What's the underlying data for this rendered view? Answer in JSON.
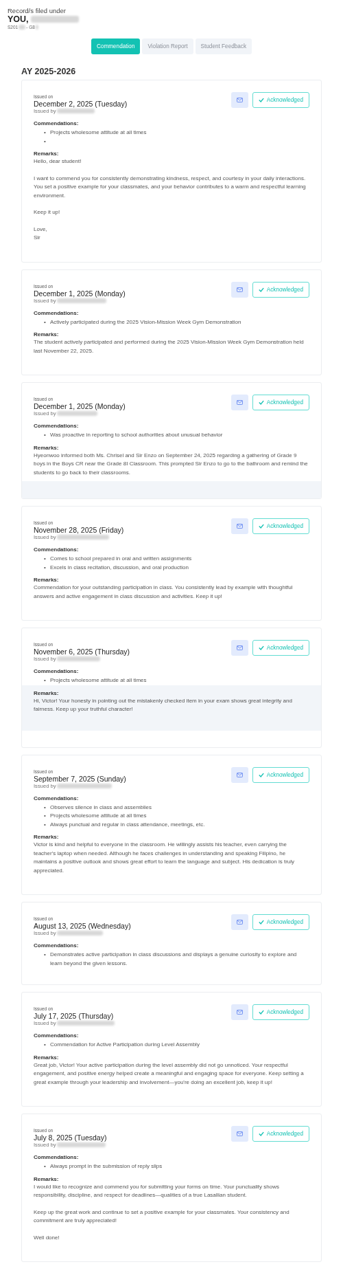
{
  "header": {
    "caption": "Record/s filed under",
    "name_prefix": "YOU,",
    "id_start": "S201",
    "id_mid": "- G8"
  },
  "tabs": [
    {
      "label": "Commendation",
      "selected": true
    },
    {
      "label": "Violation Report",
      "selected": false
    },
    {
      "label": "Student Feedback",
      "selected": false
    }
  ],
  "year": "AY 2025-2026",
  "bullet": "•",
  "records": [
    {
      "issued_on_label": "Issued on",
      "date": "December 2, 2025 (Tuesday)",
      "issued_by_label": "Issued by",
      "acknowledged": true,
      "ack_label": "Acknowledged",
      "commendations_label": "Commendations:",
      "commendations": [
        "Projects wholesome attitude at all times"
      ],
      "trailing_empty_item": true,
      "remarks_label": "Remarks:",
      "remarks": [
        "Hello, dear student!",
        "I want to commend you for consistently demonstrating kindness, respect, and courtesy in your daily interactions.\nYou set a positive example for your classmates, and your behavior contributes to a warm and respectful learning environment.",
        "Keep it up!",
        "Love,\nSir"
      ]
    },
    {
      "issued_on_label": "Issued on",
      "date": "December 1, 2025 (Monday)",
      "issued_by_label": "Issued by",
      "acknowledged": true,
      "ack_label": "Acknowledged",
      "commendations_label": "Commendations:",
      "commendations": [
        "Actively participated during the 2025 Vision-Mission Week Gym Demonstration"
      ],
      "remarks_label": "Remarks:",
      "remarks": [
        "The student actively participated and performed during the 2025 Vision-Mission Week Gym Demonstration held last November 22, 2025."
      ]
    },
    {
      "issued_on_label": "Issued on",
      "date": "December 1, 2025 (Monday)",
      "issued_by_label": "Issued by",
      "acknowledged": true,
      "ack_label": "Acknowledged",
      "commendations_label": "Commendations:",
      "commendations": [
        "Was proactive in reporting to school authorities about unusual behavior"
      ],
      "remarks_label": "Remarks:",
      "remarks": [
        "Hyeonwoo informed both Ms. Chrisel and Sir Enzo on September 24, 2025 regarding a gathering of Grade 9 boys in the Boys CR near the Grade 8I Classroom. This prompted Sir Enzo to go to the bathroom and remind the students to go back to their classrooms."
      ],
      "footer_shaded": true
    },
    {
      "issued_on_label": "Issued on",
      "date": "November 28, 2025 (Friday)",
      "issued_by_label": "Issued by",
      "acknowledged": true,
      "ack_label": "Acknowledged",
      "commendations_label": "Commendations:",
      "commendations": [
        "Comes to school prepared in oral and written assignments",
        "Excels in class recitation, discussion, and oral production"
      ],
      "remarks_label": "Remarks:",
      "remarks": [
        "Commendation for your outstanding participation in class. You consistently lead by example with thoughtful answers and active engagement in class discussion and activities. Keep it up!"
      ]
    },
    {
      "issued_on_label": "Issued on",
      "date": "November 6, 2025 (Thursday)",
      "issued_by_label": "Issued by",
      "acknowledged": true,
      "ack_label": "Acknowledged",
      "commendations_label": "Commendations:",
      "commendations": [
        "Projects wholesome attitude at all times"
      ],
      "remarks_label": "Remarks:",
      "remarks": [
        "Hi, Victor! Your honesty in pointing out the mistakenly checked item in your exam shows great integrity and fairness. Keep up your truthful character!"
      ],
      "remarks_highlighted": true
    },
    {
      "issued_on_label": "Issued on",
      "date": "September 7, 2025 (Sunday)",
      "issued_by_label": "Issued by",
      "acknowledged": true,
      "ack_label": "Acknowledged",
      "commendations_label": "Commendations:",
      "commendations": [
        "Observes silence in class and assemblies",
        "Projects wholesome attitude at all times",
        "Always punctual and regular in class attendance, meetings, etc."
      ],
      "remarks_label": "Remarks:",
      "remarks": [
        "Victor is kind and helpful to everyone in the classroom. He willingly assists his teacher, even carrying the teacher's laptop when needed. Although he faces challenges in understanding and speaking Filipino, he maintains a positive outlook and shows great effort to learn the language and subject. His dedication is truly appreciated."
      ]
    },
    {
      "issued_on_label": "Issued on",
      "date": "August 13, 2025 (Wednesday)",
      "issued_by_label": "Issued by",
      "acknowledged": true,
      "ack_label": "Acknowledged",
      "commendations_label": "Commendations:",
      "commendations": [
        "Demonstrates active participation in class discussions and displays a genuine curiosity to explore and learn beyond the given lessons."
      ]
    },
    {
      "issued_on_label": "Issued on",
      "date": "July 17, 2025 (Thursday)",
      "issued_by_label": "Issued by",
      "acknowledged": true,
      "ack_label": "Acknowledged",
      "commendations_label": "Commendations:",
      "commendations": [
        "Commendation for Active Participation during Level Assembly"
      ],
      "remarks_label": "Remarks:",
      "remarks": [
        "Great job, Victor! Your active participation during the level assembly did not go unnoticed. Your respectful engagement, and positive energy helped create a meaningful and engaging space for everyone. Keep setting a great example through your leadership and involvement—you're doing an excellent job, keep it up!"
      ]
    },
    {
      "issued_on_label": "Issued on",
      "date": "July 8, 2025 (Tuesday)",
      "issued_by_label": "Issued by",
      "acknowledged": true,
      "ack_label": "Acknowledged",
      "commendations_label": "Commendations:",
      "commendations": [
        "Always prompt in the submission of reply slips"
      ],
      "remarks_label": "Remarks:",
      "remarks": [
        "I would like to recognize and commend you for submitting your forms on time. Your punctuality shows responsibility, discipline, and respect for deadlines—qualities of a true Lasallian student.",
        "Keep up the great work and continue to set a positive example for your classmates. Your consistency and commitment are truly appreciated!",
        "Well done!"
      ]
    }
  ]
}
